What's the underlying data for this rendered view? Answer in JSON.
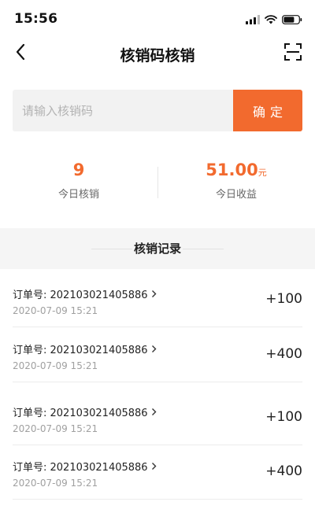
{
  "status_bar": {
    "time": "15:56",
    "icons": [
      "signal-icon",
      "wifi-icon",
      "battery-icon"
    ]
  },
  "nav": {
    "title": "核销码核销",
    "back_icon": "back-arrow-icon",
    "scan_icon": "scan-icon"
  },
  "search": {
    "placeholder": "请输入核销码",
    "value": "",
    "confirm_label": "确定"
  },
  "stats": {
    "count_value": "9",
    "count_label": "今日核销",
    "income_value": "51.00",
    "income_unit": "元",
    "income_label": "今日收益"
  },
  "records": {
    "title": "核销记录",
    "items": [
      {
        "order": "订单号: 202103021405886",
        "date": "2020-07-09 15:21",
        "amount": "+100"
      },
      {
        "order": "订单号: 202103021405886",
        "date": "2020-07-09 15:21",
        "amount": "+400"
      },
      {
        "order": "订单号: 202103021405886",
        "date": "2020-07-09 15:21",
        "amount": "+100"
      },
      {
        "order": "订单号: 202103021405886",
        "date": "2020-07-09 15:21",
        "amount": "+400"
      }
    ]
  },
  "colors": {
    "accent": "#f26a2e",
    "section_bg": "#f5f5f5",
    "input_bg": "#f2f2f2"
  }
}
